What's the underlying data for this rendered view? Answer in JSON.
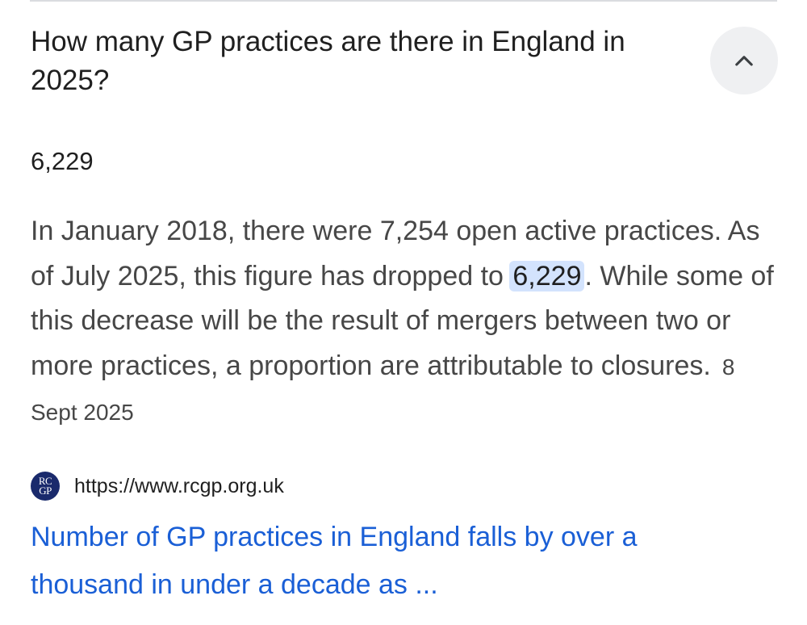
{
  "faq": {
    "question": "How many GP practices are there in England in 2025?",
    "collapse_icon": "chevron-up-icon",
    "answer_value": "6,229",
    "answer_text_before": "In January 2018, there were 7,254 open active practices. As of July 2025, this figure has dropped to ",
    "answer_highlight": "6,229",
    "answer_text_after": ". While some of this decrease will be the result of mergers between two or more practices, a proportion are attributable to closures.",
    "answer_date": "8 Sept 2025"
  },
  "source": {
    "logo_line1": "RC",
    "logo_line2": "GP",
    "url": "https://www.rcgp.org.uk",
    "title": "Number of GP practices in England falls by over a thousand in under a decade as ..."
  },
  "colors": {
    "link": "#1a5fd6",
    "highlight": "#d3e3fd",
    "button_bg": "#eff0f2"
  }
}
